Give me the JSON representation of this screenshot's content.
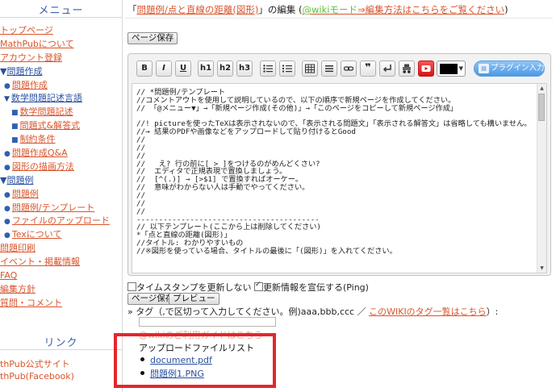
{
  "sidebar": {
    "menu_title": "メニュー",
    "items": [
      {
        "label": "トップページ",
        "level": 1,
        "marker": ""
      },
      {
        "label": "MathPubについて",
        "level": 1,
        "marker": ""
      },
      {
        "label": "アカウント登録",
        "level": 1,
        "marker": ""
      },
      {
        "label": "問題作成",
        "level": 1,
        "marker": "▼"
      },
      {
        "label": "問題作成",
        "level": 2,
        "marker": "●"
      },
      {
        "label": "数学問題記述言語",
        "level": 2,
        "marker": "▼"
      },
      {
        "label": "数学問題記述",
        "level": 3,
        "marker": "■"
      },
      {
        "label": "問題式&解答式",
        "level": 3,
        "marker": "■"
      },
      {
        "label": "制約条件",
        "level": 3,
        "marker": "■"
      },
      {
        "label": "問題作成Q&A",
        "level": 2,
        "marker": "●"
      },
      {
        "label": "図形の描画方法",
        "level": 2,
        "marker": "●"
      },
      {
        "label": "問題例",
        "level": 1,
        "marker": "▼"
      },
      {
        "label": "問題例",
        "level": 2,
        "marker": "●"
      },
      {
        "label": "問題例/テンプレート",
        "level": 2,
        "marker": "●"
      },
      {
        "label": "ファイルのアップロード",
        "level": 2,
        "marker": "●"
      },
      {
        "label": "Texについて",
        "level": 2,
        "marker": "●"
      },
      {
        "label": "問題印刷",
        "level": 1,
        "marker": ""
      },
      {
        "label": "イベント・掲載情報",
        "level": 1,
        "marker": ""
      },
      {
        "label": "FAQ",
        "level": 1,
        "marker": ""
      },
      {
        "label": "編集方針",
        "level": 1,
        "marker": ""
      },
      {
        "label": "質問・コメント",
        "level": 1,
        "marker": ""
      }
    ],
    "link_title": "リンク",
    "links": [
      "thPub公式サイト",
      "thPub(Facebook)"
    ]
  },
  "header": {
    "prefix": "「",
    "page_link": "問題例/点と直線の距離(図形)",
    "suffix": "」の編集 (",
    "wiki_prefix": "@wikiモード",
    "wiki_link": "⇒編集方法はこちらをご覧ください",
    "close": ")"
  },
  "buttons": {
    "save_top": "ページ保存",
    "save_bottom": "ページ保存",
    "preview": "プレビュー"
  },
  "toolbar": {
    "bold": "B",
    "italic": "I",
    "underline": "U",
    "h1": "h1",
    "h2": "h2",
    "h3": "h3",
    "quote": "❞",
    "plugin": "プラグイン入力"
  },
  "colors": {
    "link": "#d9552c",
    "folder_link": "#2a4fa0",
    "highlight": "#e3272b",
    "plugin": "#4d97e3",
    "youtube": "#d21414"
  },
  "editor_text": "// *問題例/テンプレート\n//コメントアウトを使用して説明しているので、以下の順序で新規ページを作成してください。\n// 「@メニュー▼」→「新規ページ作成(その他)」→「このページをコピーして新規ページ作成」\n\n//! pictureを使ったTeXは表示されないので、「表示される問題文」「表示される解答文」は省略しても構いません。\n//→ 結果のPDFや画像などをアップロードして貼り付けるとGood\n//\n//\n//\n//   え? 行の前に[ > ]をつけるのがめんどくさい?\n//  エディタで正規表現で置換しましょう。\n//  [^(.)] → [>$1] で置換すればオーケー。\n//  意味がわからない人は手動でやってください。\n//\n//\n//\n-----------------------------------------\n// 以下テンプレート(ここから上は削除してください)\n*「点と直線の距離(図形)」\n//タイトル: わかりやすいもの\n//※図形を使っている場合、タイトルの最後に「(図形)」を入れてください。",
  "options": {
    "timestamp_label": "タイムスタンプを更新しない",
    "timestamp_checked": false,
    "notify_label": "更新情報を宣伝する(Ping)",
    "notify_checked": true
  },
  "tags": {
    "label": "» タグ（,で区切って入力してください。例)aaa,bbb,ccc ／ ",
    "link": "このWIKIのタグ一覧はこちら",
    "suffix": "）:",
    "value": ""
  },
  "uploads": {
    "help_text": "@wikiのご利用ガイドはこちら",
    "title": "アップロードファイルリスト",
    "files": [
      "document.pdf",
      "問題例1.PNG"
    ]
  }
}
